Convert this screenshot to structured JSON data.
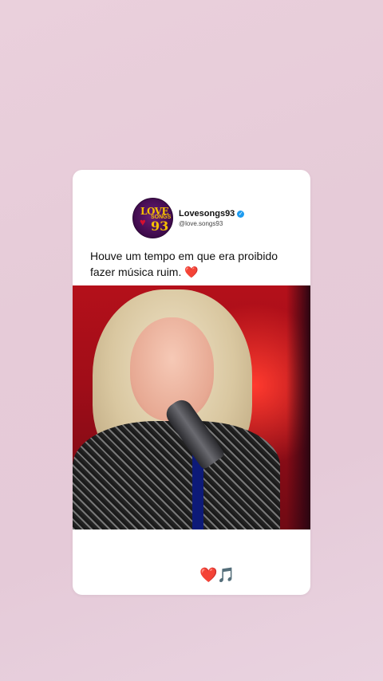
{
  "profile": {
    "name": "Lovesongs93",
    "handle": "@love.songs93",
    "avatar_text": [
      "LOVE",
      "SONGS",
      "93"
    ]
  },
  "post": {
    "caption_line1": "Houve um tempo em que era proibido",
    "caption_line2": "fazer música ruim. ❤️",
    "footer_heart": "❤️",
    "footer_note": "🎵"
  },
  "colors": {
    "background": "#e6cbd8",
    "card": "#ffffff",
    "verified": "#1d9bf0",
    "stage_red": "#b4101a"
  }
}
